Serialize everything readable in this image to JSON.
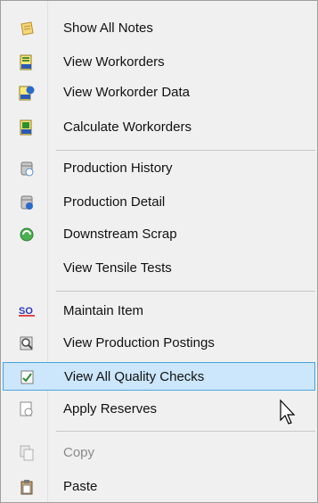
{
  "menu": {
    "items": [
      {
        "label": "Show All Notes",
        "icon": "notepad-icon"
      },
      {
        "label": "View Workorders",
        "icon": "workorder-icon"
      },
      {
        "label": "View Workorder Data",
        "icon": "workorder-info-icon"
      },
      {
        "label": "Calculate Workorders",
        "icon": "workorder-calc-icon"
      },
      {
        "label": "Production History",
        "icon": "history-db-icon"
      },
      {
        "label": "Production Detail",
        "icon": "detail-db-icon"
      },
      {
        "label": "Downstream Scrap",
        "icon": "recycle-icon"
      },
      {
        "label": "View Tensile Tests",
        "icon": ""
      },
      {
        "label": "Maintain Item",
        "icon": "so-icon"
      },
      {
        "label": "View Production Postings",
        "icon": "magnifier-doc-icon"
      },
      {
        "label": "View All Quality Checks",
        "icon": "checkmark-doc-icon"
      },
      {
        "label": "Apply Reserves",
        "icon": "doc-clock-icon"
      },
      {
        "label": "Copy",
        "icon": "copy-icon"
      },
      {
        "label": "Paste",
        "icon": "paste-icon"
      }
    ],
    "hover_color": "#cce6fb",
    "hover_border": "#4aa3e0"
  }
}
